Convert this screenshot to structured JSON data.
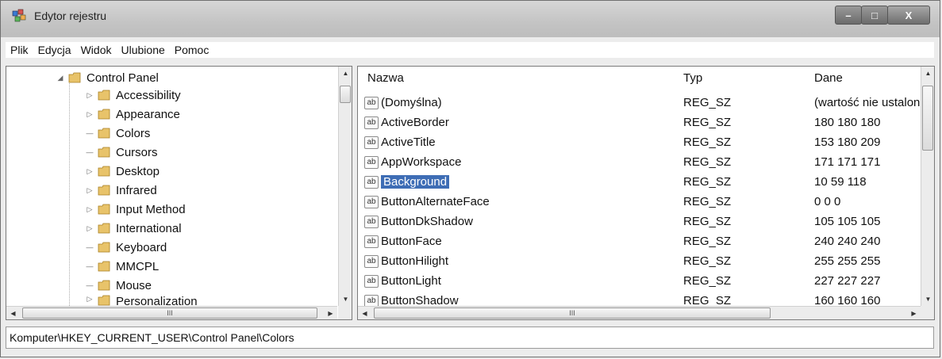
{
  "window": {
    "title": "Edytor rejestru"
  },
  "menu": [
    "Plik",
    "Edycja",
    "Widok",
    "Ulubione",
    "Pomoc"
  ],
  "tree": {
    "root": "Control Panel",
    "items": [
      {
        "label": "Accessibility",
        "expandable": true
      },
      {
        "label": "Appearance",
        "expandable": true
      },
      {
        "label": "Colors",
        "expandable": false
      },
      {
        "label": "Cursors",
        "expandable": false
      },
      {
        "label": "Desktop",
        "expandable": true
      },
      {
        "label": "Infrared",
        "expandable": true
      },
      {
        "label": "Input Method",
        "expandable": true
      },
      {
        "label": "International",
        "expandable": true
      },
      {
        "label": "Keyboard",
        "expandable": false
      },
      {
        "label": "MMCPL",
        "expandable": false
      },
      {
        "label": "Mouse",
        "expandable": false
      },
      {
        "label": "Personalization",
        "expandable": true
      }
    ],
    "hscroll_ellipsis": "III"
  },
  "list": {
    "headers": {
      "name": "Nazwa",
      "type": "Typ",
      "data": "Dane"
    },
    "rows": [
      {
        "name": "(Domyślna)",
        "type": "REG_SZ",
        "data": "(wartość nie ustalon"
      },
      {
        "name": "ActiveBorder",
        "type": "REG_SZ",
        "data": "180 180 180"
      },
      {
        "name": "ActiveTitle",
        "type": "REG_SZ",
        "data": "153 180 209"
      },
      {
        "name": "AppWorkspace",
        "type": "REG_SZ",
        "data": "171 171 171"
      },
      {
        "name": "Background",
        "type": "REG_SZ",
        "data": "10 59 118",
        "selected": true
      },
      {
        "name": "ButtonAlternateFace",
        "type": "REG_SZ",
        "data": "0 0 0"
      },
      {
        "name": "ButtonDkShadow",
        "type": "REG_SZ",
        "data": "105 105 105"
      },
      {
        "name": "ButtonFace",
        "type": "REG_SZ",
        "data": "240 240 240"
      },
      {
        "name": "ButtonHilight",
        "type": "REG_SZ",
        "data": "255 255 255"
      },
      {
        "name": "ButtonLight",
        "type": "REG_SZ",
        "data": "227 227 227"
      },
      {
        "name": "ButtonShadow",
        "type": "REG_SZ",
        "data": "160 160 160"
      }
    ],
    "icon_text": "ab",
    "hscroll_ellipsis": "III"
  },
  "status": {
    "path": "Komputer\\HKEY_CURRENT_USER\\Control Panel\\Colors"
  },
  "colors": {
    "selection": "#3e6db5",
    "folder": "#e8c36a"
  }
}
